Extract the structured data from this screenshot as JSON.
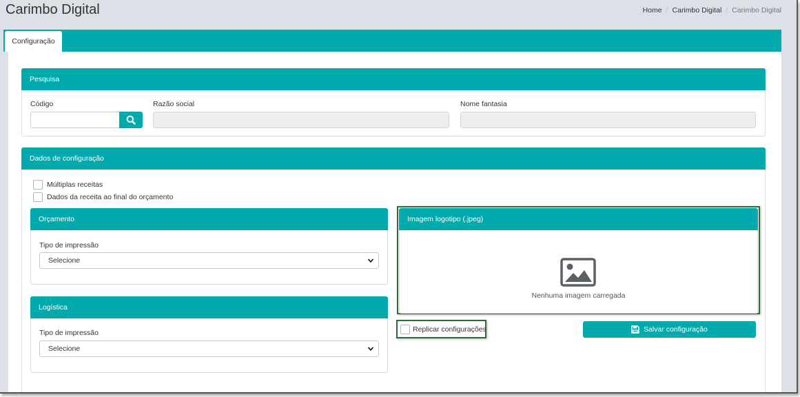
{
  "header": {
    "title": "Carimbo Digital",
    "breadcrumb": [
      "Home",
      "Carimbo Digital",
      "Carimbo Digital"
    ]
  },
  "tabs": [
    {
      "label": "Configuração",
      "active": true
    }
  ],
  "pesquisa": {
    "title": "Pesquisa",
    "codigo_label": "Código",
    "codigo_value": "",
    "razao_label": "Razão social",
    "razao_value": "",
    "fantasia_label": "Nome fantasia",
    "fantasia_value": ""
  },
  "dados": {
    "title": "Dados de configuração",
    "checkbox_multiplas": {
      "label": "Múltiplas receitas",
      "checked": false
    },
    "checkbox_dados_receita": {
      "label": "Dados da receita ao final do orçamento",
      "checked": false
    },
    "orcamento": {
      "title": "Orçamento",
      "tipo_label": "Tipo de impressão",
      "tipo_value": "Selecione"
    },
    "logistica": {
      "title": "Logística",
      "tipo_label": "Tipo de impressão",
      "tipo_value": "Selecione"
    },
    "imagem": {
      "title": "Imagem logotipo (.jpeg)",
      "empty_text": "Nenhuma imagem carregada",
      "icon": "image-placeholder-icon"
    },
    "replicar": {
      "label": "Replicar configurações",
      "checked": false
    },
    "salvar_label": "Salvar configuração"
  },
  "colors": {
    "accent": "#00aaad",
    "background": "#dde0e6",
    "highlight_frame": "#2f6b3a"
  }
}
